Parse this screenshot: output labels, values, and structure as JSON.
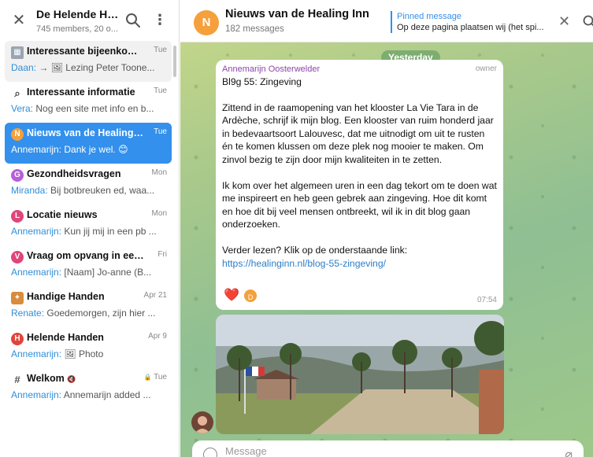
{
  "group": {
    "title": "De Helende Herb...",
    "subtitle": "745 members, 20 o..."
  },
  "topics": [
    {
      "name": "Interessante bijeenkoms...",
      "date": "Tue",
      "author": "Daan:",
      "preview": "→ 🖼 Lezing Peter Toone...",
      "icon": "picture-icon",
      "color": "#9aa5b1"
    },
    {
      "name": "Interessante informatie",
      "date": "Tue",
      "author": "Vera:",
      "preview": "Nog een site met info en b...",
      "icon": "magnifier-icon",
      "color": "#555555"
    },
    {
      "name": "Nieuws van de Healing Inn",
      "date": "Tue",
      "author": "Annemarijn:",
      "preview": "Dank je wel. 😊",
      "icon": "N",
      "color": "#f5a03a"
    },
    {
      "name": "Gezondheidsvragen",
      "date": "Mon",
      "author": "Miranda:",
      "preview": "Bij botbreuken ed, waa...",
      "icon": "G",
      "color": "#b75fd8"
    },
    {
      "name": "Locatie nieuws",
      "date": "Mon",
      "author": "Annemarijn:",
      "preview": "Kun jij mij in een pb ...",
      "icon": "L",
      "color": "#e0457b"
    },
    {
      "name": "Vraag om opvang in een ...",
      "date": "Fri",
      "author": "Annemarijn:",
      "preview": "[Naam] Jo-anne (B...",
      "icon": "V",
      "color": "#e0457b"
    },
    {
      "name": "Handige Handen",
      "date": "Apr 21",
      "author": "Renate:",
      "preview": "Goedemorgen, zijn hier ...",
      "icon": "worker-icon",
      "color": "#d98c3b"
    },
    {
      "name": "Helende Handen",
      "date": "Apr 9",
      "author": "Annemarijn:",
      "preview": "🖼 Photo",
      "icon": "H",
      "color": "#e0453b"
    },
    {
      "name": "Welkom",
      "date": "Tue",
      "author": "Annemarijn:",
      "preview": "Annemarijn added ...",
      "icon": "#",
      "color": "#555555",
      "muted": "🔇",
      "locked": "🔒"
    }
  ],
  "chat": {
    "title": "Nieuws van de Healing Inn",
    "subtitle": "182 messages",
    "avatar_letter": "N",
    "pinned_label": "Pinned message",
    "pinned_text": "Op deze pagina plaatsen wij (het spi..."
  },
  "date_label": "Yesterday",
  "message": {
    "author": "Annemarijn Oosterwelder",
    "role": "owner",
    "title": "Bl9g 55: Zingeving",
    "paragraph1": "Zittend in de raamopening van het klooster La Vie Tara in de Ardèche, schrijf ik mijn blog. Een klooster van ruim honderd jaar in bedevaartsoort Lalouvesc, dat me uitnodigt om uit te rusten én te komen klussen om deze plek nog mooier te maken. Om zinvol bezig te zijn door mijn kwaliteiten in te zetten.",
    "paragraph2": "Ik kom over het algemeen uren in een dag tekort om te doen wat me inspireert en heb geen gebrek aan zingeving. Hoe dit komt en hoe dit bij veel mensen ontbreekt, wil ik in dit blog gaan onderzoeken.",
    "paragraph3": "Verder lezen? Klik op de onderstaande link:",
    "link": "https://healinginn.nl/blog-55-zingeving/",
    "reaction": "❤️",
    "reaction_avatar": "D",
    "time": "07:54"
  },
  "composer": {
    "placeholder": "Message"
  }
}
